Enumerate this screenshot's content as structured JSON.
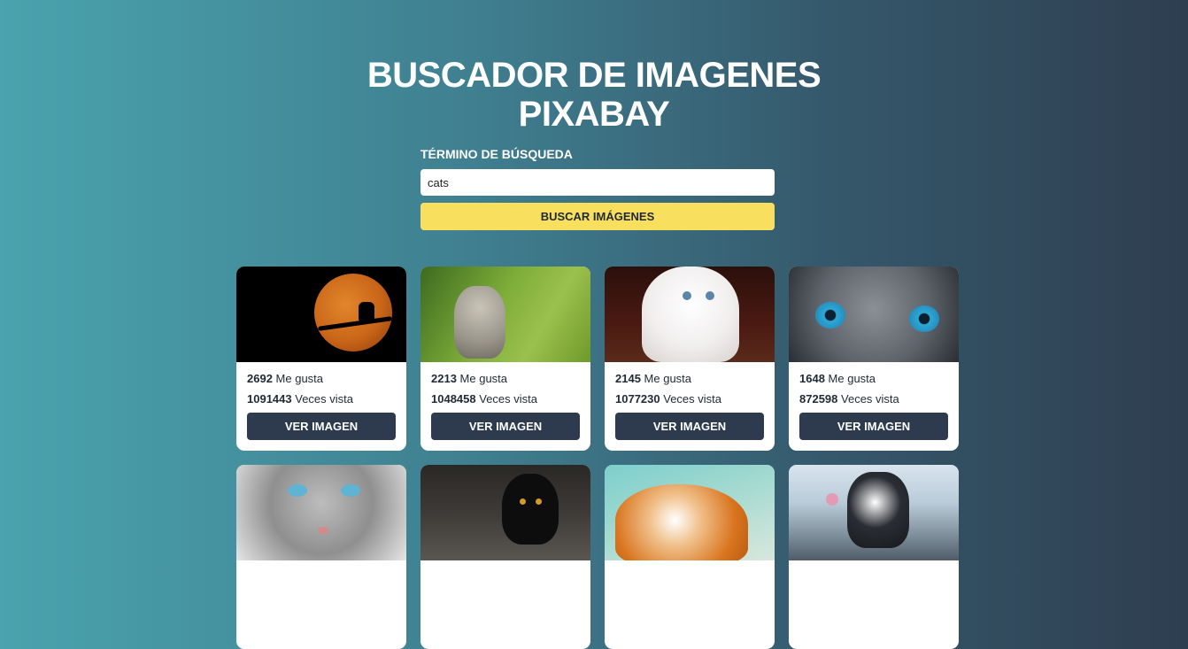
{
  "header": {
    "title_line1": "BUSCADOR DE IMAGENES",
    "title_line2": "PIXABAY"
  },
  "search": {
    "label": "TÉRMINO DE BÚSQUEDA",
    "value": "cats",
    "button_label": "BUSCAR IMÁGENES"
  },
  "results": [
    {
      "likes": "2692",
      "likes_label": "Me gusta",
      "views": "1091443",
      "views_label": "Veces vista",
      "button_label": "VER IMAGEN"
    },
    {
      "likes": "2213",
      "likes_label": "Me gusta",
      "views": "1048458",
      "views_label": "Veces vista",
      "button_label": "VER IMAGEN"
    },
    {
      "likes": "2145",
      "likes_label": "Me gusta",
      "views": "1077230",
      "views_label": "Veces vista",
      "button_label": "VER IMAGEN"
    },
    {
      "likes": "1648",
      "likes_label": "Me gusta",
      "views": "872598",
      "views_label": "Veces vista",
      "button_label": "VER IMAGEN"
    }
  ],
  "colors": {
    "gradient_start": "#4aa3ae",
    "gradient_end": "#2e3e50",
    "search_button": "#f8df5e",
    "card_button": "#2e3b4e"
  }
}
